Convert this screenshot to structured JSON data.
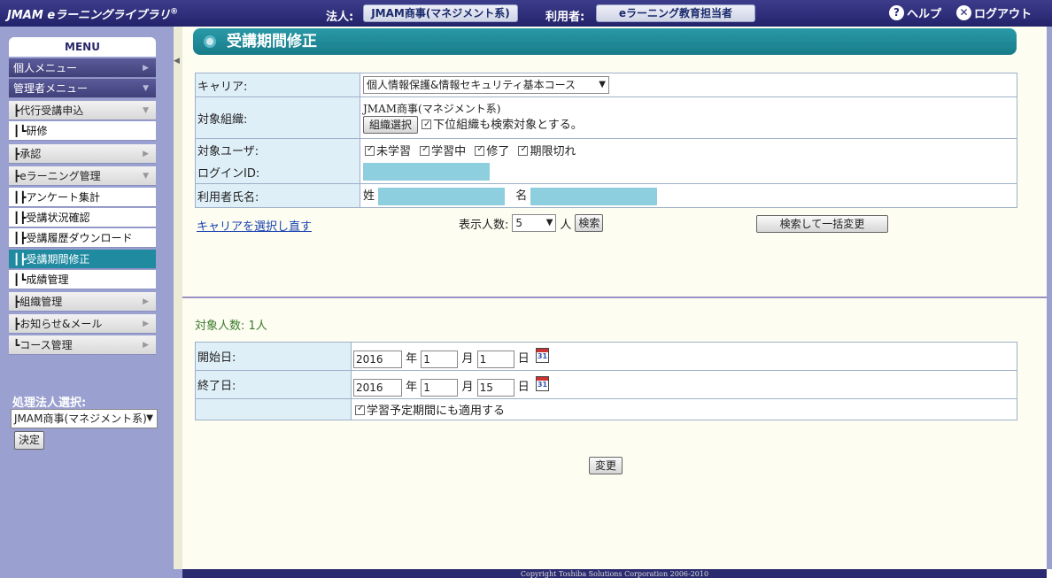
{
  "header": {
    "logo_brand": "JMAM",
    "logo_text": "eラーニングライブラリ",
    "logo_mark": "®",
    "corp_label": "法人:",
    "corp_value": "JMAM商事(マネジメント系)",
    "user_label": "利用者:",
    "user_value": "eラーニング教育担当者",
    "help": "ヘルプ",
    "logout": "ログアウト"
  },
  "sidebar": {
    "menu_title": "MENU",
    "items": [
      {
        "label": "個人メニュー"
      },
      {
        "label": "管理者メニュー"
      },
      {
        "label": "┣代行受講申込"
      },
      {
        "label": "┃┗研修"
      },
      {
        "label": "┣承認"
      },
      {
        "label": "┣eラーニング管理"
      },
      {
        "label": "┃┣アンケート集計"
      },
      {
        "label": "┃┣受講状況確認"
      },
      {
        "label": "┃┣受講履歴ダウンロード"
      },
      {
        "label": "┃┣受講期間修正"
      },
      {
        "label": "┃┗成績管理"
      },
      {
        "label": "┣組織管理"
      },
      {
        "label": "┣お知らせ&メール"
      },
      {
        "label": "┗コース管理"
      }
    ],
    "corp_select_label": "処理法人選択:",
    "corp_select_value": "JMAM商事(マネジメント系)",
    "corp_ok_button": "決定"
  },
  "page": {
    "title": "受講期間修正"
  },
  "search": {
    "career_label": "キャリア:",
    "career_value": "個人情報保護&情報セキュリティ基本コース",
    "org_label": "対象組織:",
    "org_value": "JMAM商事(マネジメント系)",
    "org_select_button": "組織選択",
    "include_sub_org": "下位組織も検索対象とする。",
    "target_user_label": "対象ユーザ:",
    "status_unlearned": "未学習",
    "status_learning": "学習中",
    "status_done": "修了",
    "status_expired": "期限切れ",
    "login_id_label": "ログインID:",
    "user_name_label": "利用者氏名:",
    "last_name_label": "姓",
    "first_name_label": "名",
    "reselect_career_link": "キャリアを選択し直す",
    "display_count_label": "表示人数:",
    "display_count_value": "5",
    "person_unit": "人",
    "search_button": "検索",
    "bulk_change_button": "検索して一括変更"
  },
  "result": {
    "target_count": "対象人数: 1人",
    "start_label": "開始日:",
    "start_year": "2016",
    "start_month": "1",
    "start_day": "1",
    "end_label": "終了日:",
    "end_year": "2016",
    "end_month": "1",
    "end_day": "15",
    "year_unit": "年",
    "month_unit": "月",
    "day_unit": "日",
    "apply_schedule": "学習予定期間にも適用する",
    "change_button": "変更"
  },
  "footer": {
    "copyright": "Copyright Toshiba Solutions Corporation 2006-2010"
  }
}
